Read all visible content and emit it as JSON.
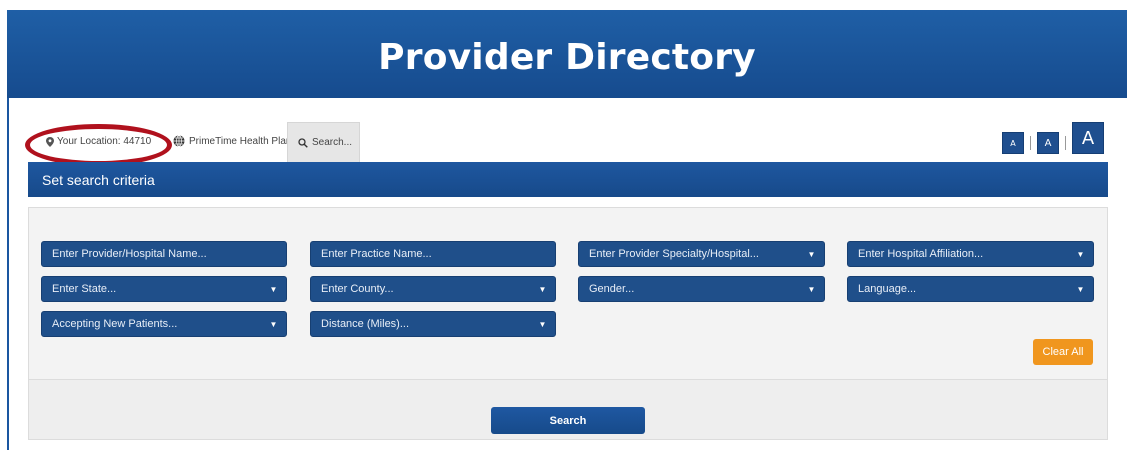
{
  "header": {
    "title": "Provider Directory"
  },
  "topbar": {
    "location": "Your Location: 44710",
    "plan": "PrimeTime Health Plan",
    "search": "Search...",
    "font_sizes": [
      "A",
      "A",
      "A"
    ]
  },
  "criteria": {
    "heading": "Set search criteria",
    "fields": [
      {
        "label": "Enter Provider/Hospital Name...",
        "dropdown": false
      },
      {
        "label": "Enter Practice Name...",
        "dropdown": false
      },
      {
        "label": "Enter Provider Specialty/Hospital...",
        "dropdown": true
      },
      {
        "label": "Enter Hospital Affiliation...",
        "dropdown": true
      },
      {
        "label": "Enter State...",
        "dropdown": true
      },
      {
        "label": "Enter County...",
        "dropdown": true
      },
      {
        "label": "Gender...",
        "dropdown": true
      },
      {
        "label": "Language...",
        "dropdown": true
      },
      {
        "label": "Accepting New Patients...",
        "dropdown": true
      },
      {
        "label": "Distance (Miles)...",
        "dropdown": true
      }
    ],
    "clear_label": "Clear All"
  },
  "search_button": "Search",
  "colors": {
    "brand_blue": "#1f4f8a",
    "highlight_red": "#b0111d",
    "clear_orange": "#f0961e"
  },
  "icons": [
    "map-pin-icon",
    "globe-icon",
    "magnifier-icon",
    "caret-down-icon"
  ]
}
